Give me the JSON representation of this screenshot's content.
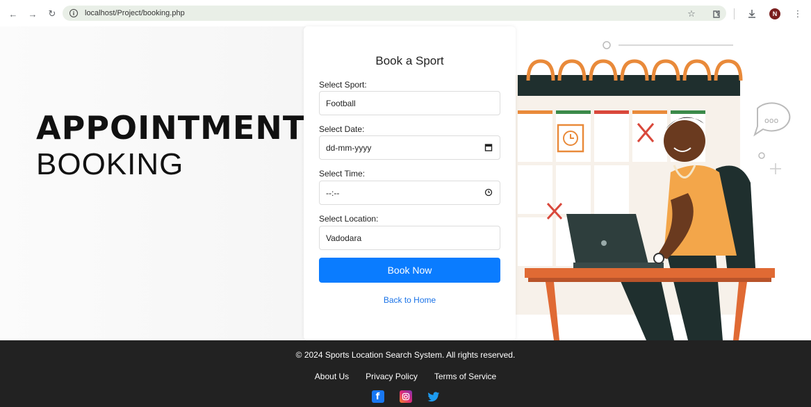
{
  "browser": {
    "url": "localhost/Project/booking.php",
    "avatar_letter": "N"
  },
  "hero": {
    "headline_line1": "APPOINTMENT",
    "headline_line2": "BOOKING"
  },
  "form": {
    "title": "Book a Sport",
    "sport_label": "Select Sport:",
    "sport_value": "Football",
    "date_label": "Select Date:",
    "date_value": "dd-mm-yyyy",
    "time_label": "Select Time:",
    "time_value": "--:--",
    "location_label": "Select Location:",
    "location_value": "Vadodara",
    "submit_label": "Book Now",
    "back_link": "Back to Home"
  },
  "footer": {
    "copyright": "© 2024 Sports Location Search System. All rights reserved.",
    "links": [
      "About Us",
      "Privacy Policy",
      "Terms of Service"
    ],
    "social": [
      "facebook-icon",
      "instagram-icon",
      "twitter-icon"
    ]
  },
  "colors": {
    "accent": "#0a7cff",
    "footer_bg": "#222222",
    "link": "#1a73e8"
  }
}
